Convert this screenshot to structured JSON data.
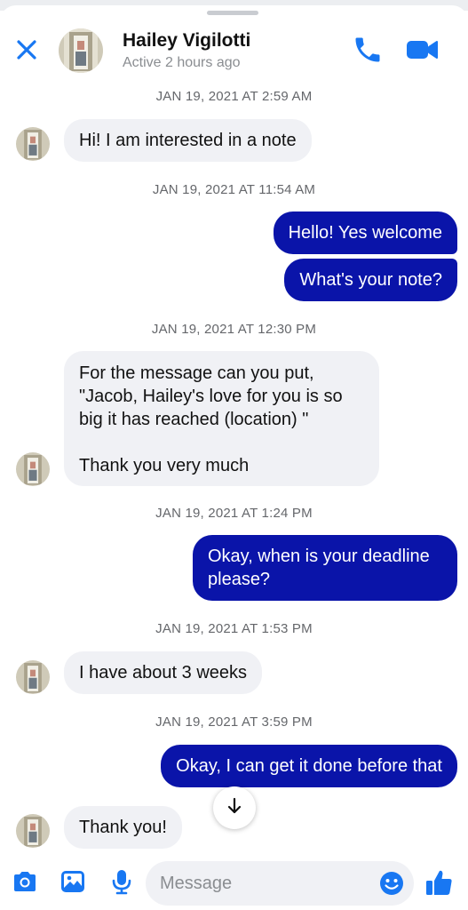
{
  "colors": {
    "accent": "#1877f2",
    "outgoing_bubble": "#0a14a9",
    "incoming_bubble": "#f0f1f5"
  },
  "header": {
    "name": "Hailey Vigilotti",
    "status": "Active 2 hours ago",
    "icons": [
      "close-icon",
      "phone-icon",
      "video-camera-icon"
    ]
  },
  "messages": [
    {
      "type": "timestamp",
      "text": "JAN 19, 2021 AT 2:59 AM"
    },
    {
      "type": "incoming",
      "text": "Hi! I am interested in a note"
    },
    {
      "type": "timestamp",
      "text": "JAN 19, 2021 AT 11:54 AM"
    },
    {
      "type": "outgoing",
      "text": "Hello! Yes welcome"
    },
    {
      "type": "outgoing",
      "text": "What's your note?"
    },
    {
      "type": "timestamp",
      "text": "JAN 19, 2021 AT 12:30 PM"
    },
    {
      "type": "incoming",
      "lines": [
        "For the message can you put,",
        "\"Jacob, Hailey's love for you is so",
        "big it has reached (location) \"",
        "",
        "Thank you very much"
      ]
    },
    {
      "type": "timestamp",
      "text": "JAN 19, 2021 AT 1:24 PM"
    },
    {
      "type": "outgoing",
      "lines": [
        "Okay, when is your deadline",
        "please?"
      ]
    },
    {
      "type": "timestamp",
      "text": "JAN 19, 2021 AT 1:53 PM"
    },
    {
      "type": "incoming",
      "text": "I have about 3 weeks"
    },
    {
      "type": "timestamp",
      "text": "JAN 19, 2021 AT 3:59 PM"
    },
    {
      "type": "outgoing",
      "text": "Okay, I can get it done before that"
    },
    {
      "type": "incoming",
      "text": "Thank you!"
    }
  ],
  "scroll_down_icon": "arrow-down-icon",
  "composer": {
    "placeholder": "Message",
    "icons": [
      "camera-icon",
      "gallery-icon",
      "microphone-icon",
      "emoji-icon",
      "thumbs-up-icon"
    ]
  }
}
